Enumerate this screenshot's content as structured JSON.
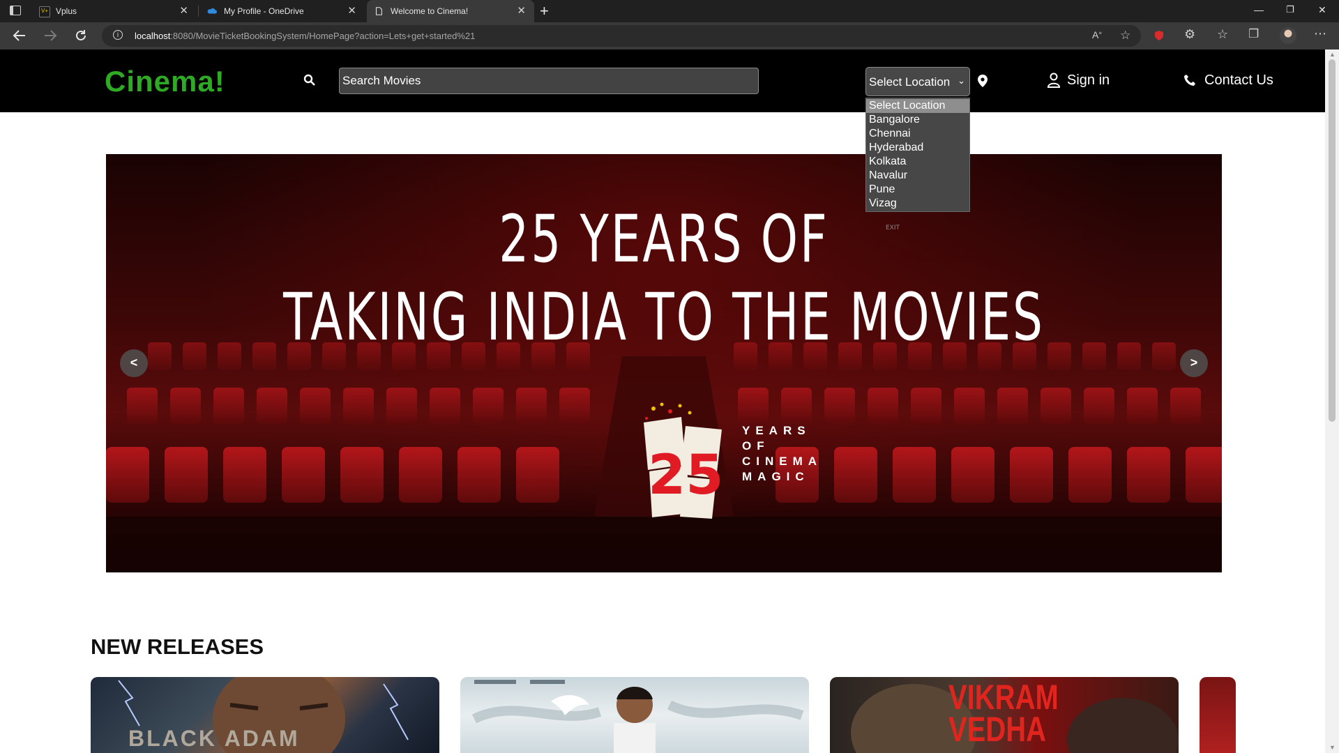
{
  "browser": {
    "tabs": [
      {
        "title": "Vplus",
        "favicon": "vplus-favicon",
        "active": false
      },
      {
        "title": "My Profile - OneDrive",
        "favicon": "onedrive-favicon",
        "active": false
      },
      {
        "title": "Welcome to Cinema!",
        "favicon": "page-favicon",
        "active": true
      }
    ],
    "new_tab_label": "+",
    "url_host": "localhost",
    "url_path": ":8080/MovieTicketBookingSystem/HomePage?action=Lets+get+started%21"
  },
  "header": {
    "logo": "Cinema!",
    "logo_color": "#2eaa24",
    "search_placeholder": "Search Movies",
    "location_selected": "Select Location",
    "location_options": [
      "Select Location",
      "Bangalore",
      "Chennai",
      "Hyderabad",
      "Kolkata",
      "Navalur",
      "Pune",
      "Vizag"
    ],
    "signin_label": "Sign in",
    "contact_label": "Contact Us"
  },
  "banner": {
    "headline_line1": "25 YEARS OF",
    "headline_line2": "TAKING INDIA TO THE MOVIES",
    "badge_number": "25",
    "badge_line1": "YEARS",
    "badge_line2": "OF",
    "badge_line3": "CINEMA",
    "badge_line4": "MAGIC",
    "badge_accent": "#e01b24",
    "prev_label": "<",
    "next_label": ">",
    "exit_sign": "EXIT"
  },
  "new_releases": {
    "title": "NEW RELEASES",
    "posters": [
      {
        "title_text": "BLACK ADAM"
      },
      {
        "title_text": ""
      },
      {
        "title_text": "VIKRAM VEDHA"
      },
      {
        "title_text": ""
      }
    ]
  }
}
